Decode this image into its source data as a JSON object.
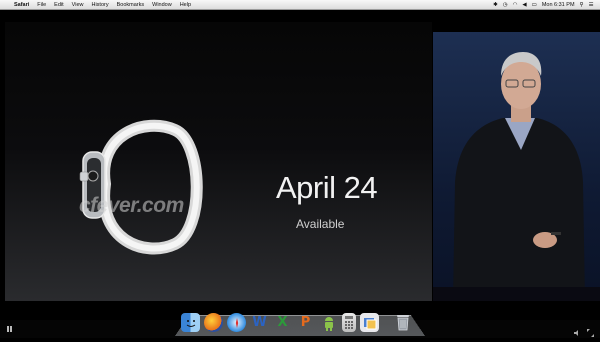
{
  "menubar": {
    "apple_glyph": "",
    "app_name": "Safari",
    "items": [
      "File",
      "Edit",
      "View",
      "History",
      "Bookmarks",
      "Window",
      "Help"
    ],
    "clock": "Mon 6:31 PM"
  },
  "slide": {
    "title": "April 24",
    "subtitle": "Available",
    "watermark": "cfever.com"
  },
  "dock": {
    "icons": [
      "finder-icon",
      "firefox-icon",
      "safari-icon",
      "word-icon",
      "excel-icon",
      "powerpoint-icon",
      "android-icon",
      "calculator-icon",
      "preview-icon",
      "trash-icon"
    ]
  },
  "colors": {
    "word": "#2b63c2",
    "excel": "#2c9a3a",
    "powerpoint": "#e46a1d",
    "android": "#8bc34a"
  }
}
